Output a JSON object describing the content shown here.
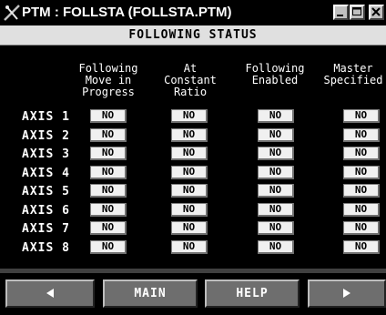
{
  "window": {
    "title": "PTM : FOLLSTA (FOLLSTA.PTM)",
    "icon": "ptm-app-icon"
  },
  "header": {
    "title": "FOLLOWING STATUS"
  },
  "columns": [
    "Following\nMove in\nProgress",
    "At\nConstant\nRatio",
    "Following\nEnabled",
    "Master\nSpecified"
  ],
  "axes": [
    {
      "label": "AXIS 1",
      "values": [
        "NO",
        "NO",
        "NO",
        "NO"
      ]
    },
    {
      "label": "AXIS 2",
      "values": [
        "NO",
        "NO",
        "NO",
        "NO"
      ]
    },
    {
      "label": "AXIS 3",
      "values": [
        "NO",
        "NO",
        "NO",
        "NO"
      ]
    },
    {
      "label": "AXIS 4",
      "values": [
        "NO",
        "NO",
        "NO",
        "NO"
      ]
    },
    {
      "label": "AXIS 5",
      "values": [
        "NO",
        "NO",
        "NO",
        "NO"
      ]
    },
    {
      "label": "AXIS 6",
      "values": [
        "NO",
        "NO",
        "NO",
        "NO"
      ]
    },
    {
      "label": "AXIS 7",
      "values": [
        "NO",
        "NO",
        "NO",
        "NO"
      ]
    },
    {
      "label": "AXIS 8",
      "values": [
        "NO",
        "NO",
        "NO",
        "NO"
      ]
    }
  ],
  "nav": {
    "prev_icon": "left-arrow-icon",
    "main_label": "MAIN",
    "help_label": "HELP",
    "next_icon": "right-arrow-icon"
  }
}
